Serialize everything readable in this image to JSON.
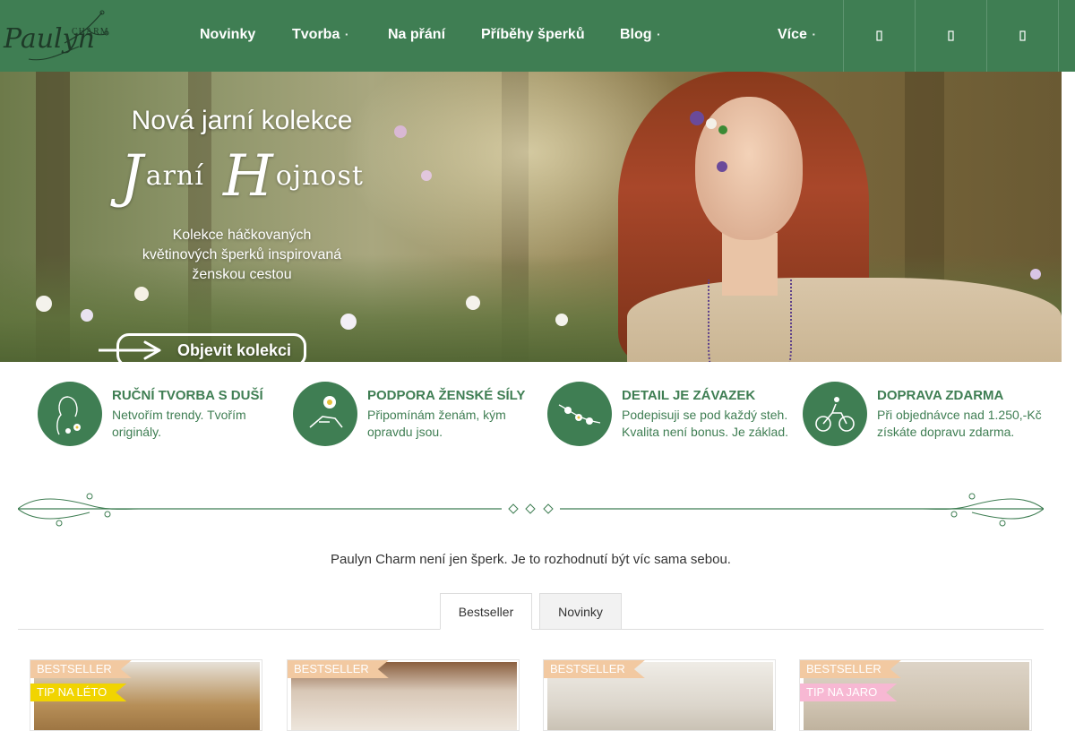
{
  "brand": {
    "script": "Paulyn",
    "charm": "CHARM"
  },
  "nav": {
    "items": [
      {
        "label": "Novinky",
        "dropdown": false
      },
      {
        "label": "Tvorba",
        "dropdown": true
      },
      {
        "label": "Na přání",
        "dropdown": false
      },
      {
        "label": "Příběhy šperků",
        "dropdown": false
      },
      {
        "label": "Blog",
        "dropdown": true
      },
      {
        "label": "Více",
        "dropdown": true
      }
    ],
    "caret": "▪",
    "icons": [
      "search-icon",
      "user-icon",
      "cart-icon"
    ]
  },
  "hero": {
    "title": "Nová jarní kolekce",
    "script_cap1": "J",
    "script_word1": "arní",
    "script_cap2": "H",
    "script_word2": "ojnost",
    "description_lines": [
      "Kolekce háčkovaných",
      "květinových šperků inspirovaná",
      "ženskou cestou"
    ],
    "cta": "Objevit kolekci"
  },
  "features": [
    {
      "title": "RUČNÍ TVORBA S DUŠÍ",
      "text": "Netvořím trendy. Tvořím originály.",
      "icon": "woman-flower-icon"
    },
    {
      "title": "PODPORA ŽENSKÉ SÍLY",
      "text": "Připomínám ženám, kým opravdu jsou.",
      "icon": "hands-daisy-icon"
    },
    {
      "title": "DETAIL JE ZÁVAZEK",
      "text": "Podepisuji se pod každý steh. Kvalita není bonus. Je základ.",
      "icon": "flower-chain-icon"
    },
    {
      "title": "DOPRAVA ZDARMA",
      "text": "Při objednávce nad 1.250,-Kč získáte dopravu zdarma.",
      "icon": "bicycle-icon"
    }
  ],
  "tagline": "Paulyn Charm není jen šperk. Je to rozhodnutí být víc sama sebou.",
  "tabs": [
    {
      "label": "Bestseller",
      "active": true
    },
    {
      "label": "Novinky",
      "active": false
    }
  ],
  "products": [
    {
      "badges": [
        "BESTSELLER",
        "TIP NA LÉTO"
      ]
    },
    {
      "badges": [
        "BESTSELLER"
      ]
    },
    {
      "badges": [
        "BESTSELLER"
      ]
    },
    {
      "badges": [
        "BESTSELLER",
        "TIP NA JARO"
      ]
    }
  ],
  "colors": {
    "brand_green": "#3f7e53",
    "badge_bestseller": "#f2c9a1",
    "badge_summer": "#f1d400",
    "badge_spring": "#f7b8d3"
  }
}
